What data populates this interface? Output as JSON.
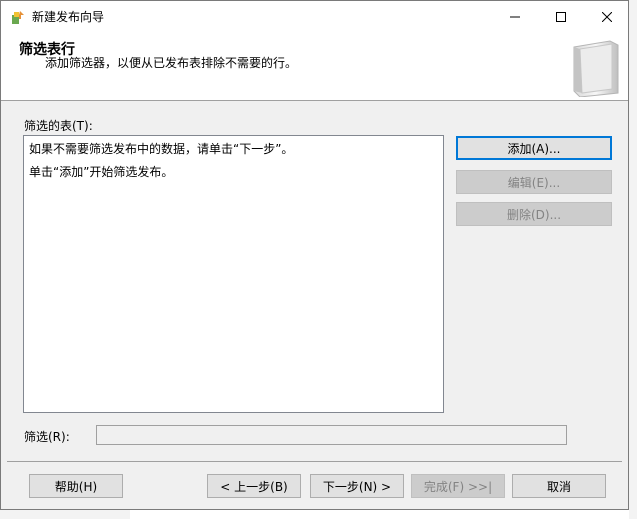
{
  "window": {
    "title": "新建发布向导",
    "minimize_glyph": "—",
    "maximize_glyph": "☐",
    "close_glyph": "✕"
  },
  "header": {
    "title": "筛选表行",
    "subtitle": "添加筛选器，以便从已发布表排除不需要的行。"
  },
  "filtered_tables": {
    "label": "筛选的表(T):",
    "lines": [
      "如果不需要筛选发布中的数据，请单击“下一步”。",
      "单击“添加”开始筛选发布。"
    ]
  },
  "side_buttons": {
    "add": "添加(A)...",
    "edit": "编辑(E)...",
    "delete": "删除(D)..."
  },
  "filter": {
    "label": "筛选(R):",
    "value": ""
  },
  "footer": {
    "help": "帮助(H)",
    "back": "< 上一步(B)",
    "next": "下一步(N) >",
    "finish": "完成(F) >>|",
    "cancel": "取消"
  }
}
